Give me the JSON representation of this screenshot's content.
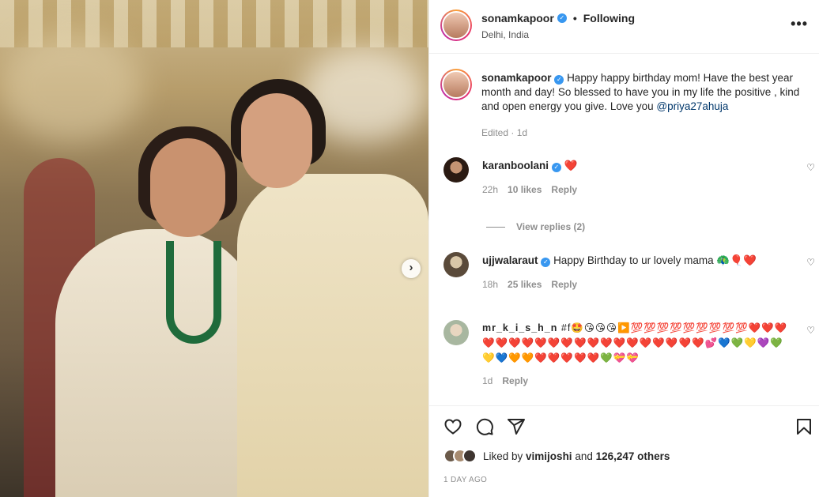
{
  "post_header": {
    "username": "sonamkapoor",
    "separator": "•",
    "follow_status": "Following",
    "location": "Delhi, India",
    "more_icon": "more-horizontal-icon",
    "more_label": "•••"
  },
  "caption": {
    "username": "sonamkapoor",
    "text": "Happy happy birthday mom! Have the best year month and day! So blessed to have you in my life the positive , kind and open energy you give. Love you ",
    "mention": "@priya27ahuja",
    "meta": "Edited · 1d"
  },
  "comments": [
    {
      "username": "karanboolani",
      "text": "❤️",
      "time": "22h",
      "likes": "10 likes",
      "reply": "Reply",
      "view_replies": "View replies (2)"
    },
    {
      "username": "ujjwalaraut",
      "text": "Happy Birthday to ur lovely mama 🦚🎈❤️",
      "time": "18h",
      "likes": "25 likes",
      "reply": "Reply"
    },
    {
      "username": "mr_k_i_s_h_n",
      "text": "#f🤩😘😘😘▶️💯💯💯💯💯💯💯💯💯❤️❤️❤️❤️❤️❤️❤️❤️❤️❤️❤️❤️❤️❤️❤️❤️❤️❤️❤️❤️💕💙💚💛💜💚💛💙🧡🧡❤️❤️❤️❤️❤️💚💝💝",
      "time": "1d",
      "reply": "Reply"
    }
  ],
  "actions": {
    "like_icon": "heart-outline-icon",
    "comment_icon": "comment-bubble-icon",
    "share_icon": "paper-plane-icon",
    "save_icon": "bookmark-icon"
  },
  "likes": {
    "prefix": "Liked by ",
    "first_liker": "vimijoshi",
    "middle": " and ",
    "others": "126,247 others"
  },
  "date": "1 DAY AGO",
  "photo": {
    "next_label": "›"
  },
  "colors": {
    "verified": "#3897f0",
    "mention": "#00376b",
    "like_red": "#ed4956",
    "secondary_text": "#8e8e8e"
  }
}
